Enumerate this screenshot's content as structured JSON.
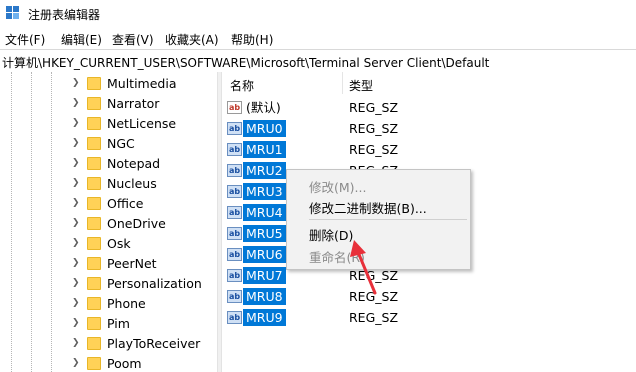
{
  "window": {
    "title": "注册表编辑器"
  },
  "menu": [
    "文件(F)",
    "编辑(E)",
    "查看(V)",
    "收藏夹(A)",
    "帮助(H)"
  ],
  "address": "计算机\\HKEY_CURRENT_USER\\SOFTWARE\\Microsoft\\Terminal Server Client\\Default",
  "tree": {
    "items": [
      "Multimedia",
      "Narrator",
      "NetLicense",
      "NGC",
      "Notepad",
      "Nucleus",
      "Office",
      "OneDrive",
      "Osk",
      "PeerNet",
      "Personalization",
      "Phone",
      "Pim",
      "PlayToReceiver",
      "Poom"
    ]
  },
  "list": {
    "headers": {
      "name": "名称",
      "type": "类型"
    },
    "rows": [
      {
        "name": "(默认)",
        "type": "REG_SZ",
        "selected": false
      },
      {
        "name": "MRU0",
        "type": "REG_SZ",
        "selected": true
      },
      {
        "name": "MRU1",
        "type": "REG_SZ",
        "selected": true
      },
      {
        "name": "MRU2",
        "type": "REG_SZ",
        "selected": true
      },
      {
        "name": "MRU3",
        "type": "REG_SZ",
        "selected": true
      },
      {
        "name": "MRU4",
        "type": "REG_SZ",
        "selected": true
      },
      {
        "name": "MRU5",
        "type": "REG_SZ",
        "selected": true
      },
      {
        "name": "MRU6",
        "type": "REG_SZ",
        "selected": true
      },
      {
        "name": "MRU7",
        "type": "REG_SZ",
        "selected": true
      },
      {
        "name": "MRU8",
        "type": "REG_SZ",
        "selected": true
      },
      {
        "name": "MRU9",
        "type": "REG_SZ",
        "selected": true
      }
    ]
  },
  "context_menu": {
    "items": [
      {
        "label": "修改(M)...",
        "disabled": true
      },
      {
        "label": "修改二进制数据(B)...",
        "disabled": false
      },
      {
        "label": "删除(D)",
        "disabled": false
      },
      {
        "label": "重命名(R)",
        "disabled": true
      }
    ]
  },
  "colors": {
    "selection": "#0078d7",
    "folder": "#ffd257",
    "annotation_arrow": "#e8303a"
  },
  "icons": {
    "app": "regedit-icon",
    "folder": "folder-icon",
    "string_value": "ab-string-icon",
    "expand": "chevron-right-icon"
  }
}
